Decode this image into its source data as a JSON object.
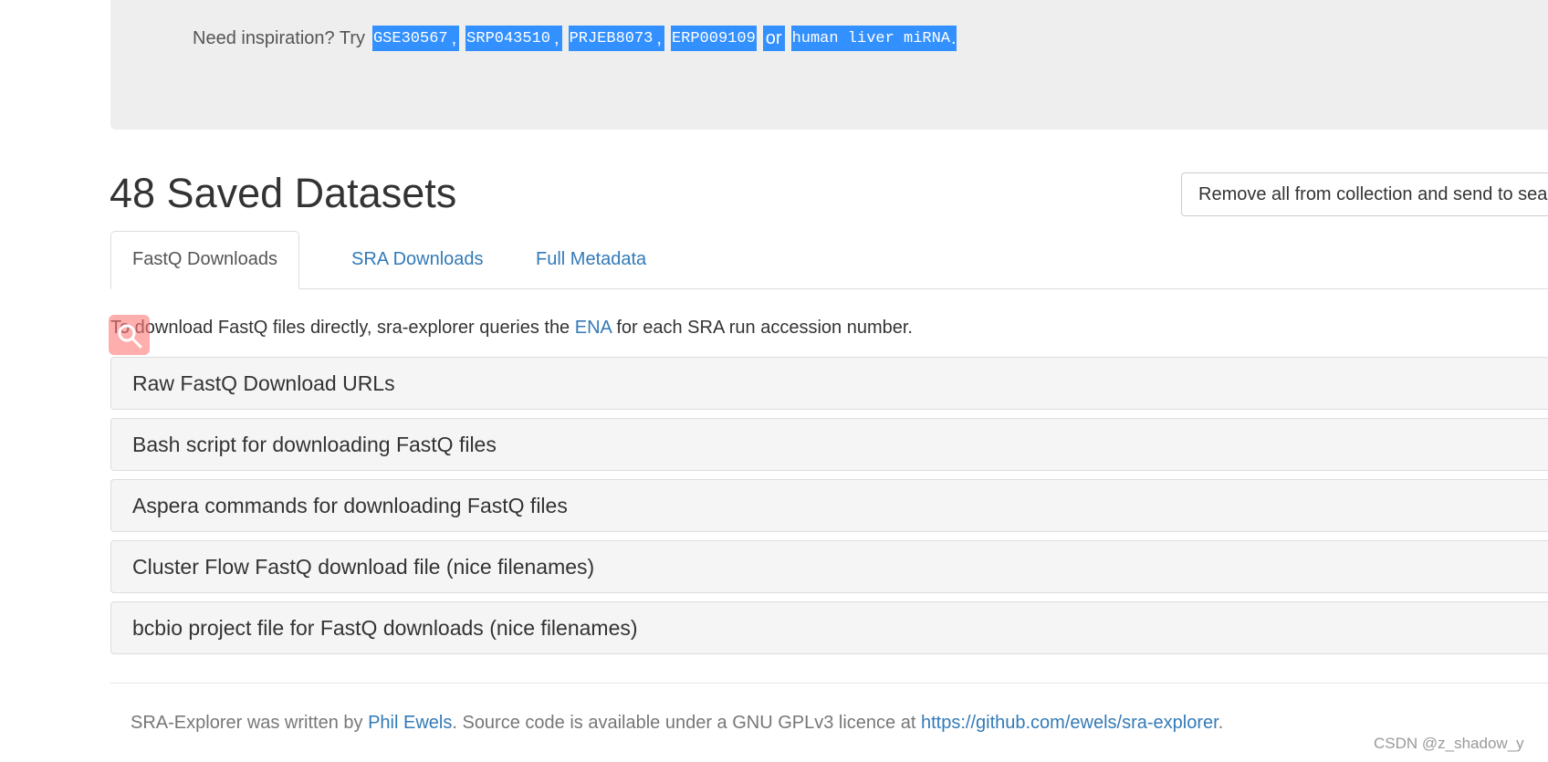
{
  "search": {
    "inspiration_prefix": "Need inspiration? Try",
    "examples": [
      "GSE30567",
      "SRP043510",
      "PRJEB8073",
      "ERP009109"
    ],
    "separator": ",",
    "or_word": "or",
    "last_example": "human liver miRNA",
    "end": "."
  },
  "page": {
    "title": "48 Saved Datasets",
    "remove_button": "Remove all from collection and send to search"
  },
  "tabs": [
    {
      "label": "FastQ Downloads",
      "active": true
    },
    {
      "label": "SRA Downloads",
      "active": false
    },
    {
      "label": "Full Metadata",
      "active": false
    }
  ],
  "intro": {
    "before": "To download FastQ files directly, sra-explorer queries the",
    "link": "ENA",
    "after": "for each SRA run accession number."
  },
  "panels": [
    "Raw FastQ Download URLs",
    "Bash script for downloading FastQ files",
    "Aspera commands for downloading FastQ files",
    "Cluster Flow FastQ download file (nice filenames)",
    "bcbio project file for FastQ downloads (nice filenames)"
  ],
  "footer": {
    "p1_before": "SRA-Explorer was written by",
    "author": "Phil Ewels",
    "p1_middle": ". Source code is available under a GNU GPLv3 licence at",
    "repo": "https://github.com/ewels/sra-explorer",
    "p1_end": "."
  },
  "watermark": "CSDN @z_shadow_y",
  "colors": {
    "link": "#337ab7",
    "selection": "#3390ff",
    "jumbotron": "#eeeeee",
    "panel": "#f5f5f5",
    "marker": "#ff7878"
  }
}
